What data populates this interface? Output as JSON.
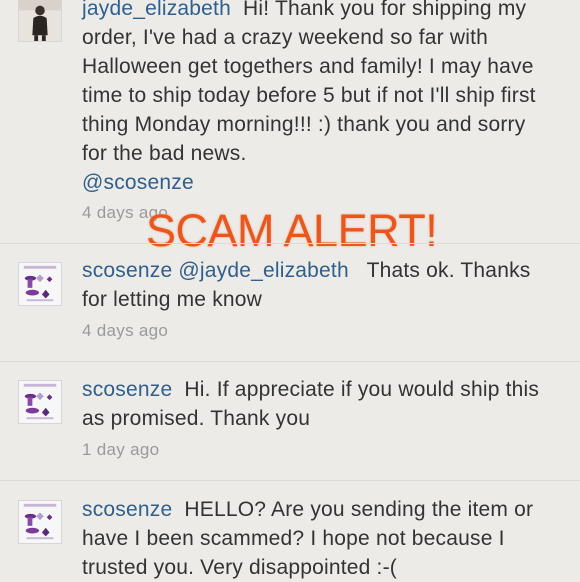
{
  "comments": [
    {
      "username": "jayde_elizabeth",
      "text": "Hi! Thank you for shipping my order, I've had a crazy weekend so far with Halloween get togethers and family! I may have time to ship today before 5 but if not I'll ship first thing Monday morning!!! :) thank you and sorry for the bad news.",
      "mention": "@scosenze",
      "time": "4 days ago"
    },
    {
      "username": "scosenze",
      "mention": "@jayde_elizabeth",
      "text": "Thats ok. Thanks for letting me know",
      "time": "4 days ago"
    },
    {
      "username": "scosenze",
      "text": "Hi. If appreciate if you would ship this as promised. Thank you",
      "time": "1 day ago"
    },
    {
      "username": "scosenze",
      "text": "HELLO? Are you sending the item or have I been scammed? I hope not because I trusted you. Very disappointed :-("
    }
  ],
  "overlay": {
    "text": "SCAM ALERT!",
    "color": "#e8571e"
  },
  "colors": {
    "username": "#2f5f8c",
    "body_text": "#333333",
    "timestamp": "#9a9a9a",
    "background": "#ecebe8"
  },
  "icons": {
    "avatar_1": "user-photo-avatar",
    "avatar_2": "shop-logo-avatar"
  }
}
